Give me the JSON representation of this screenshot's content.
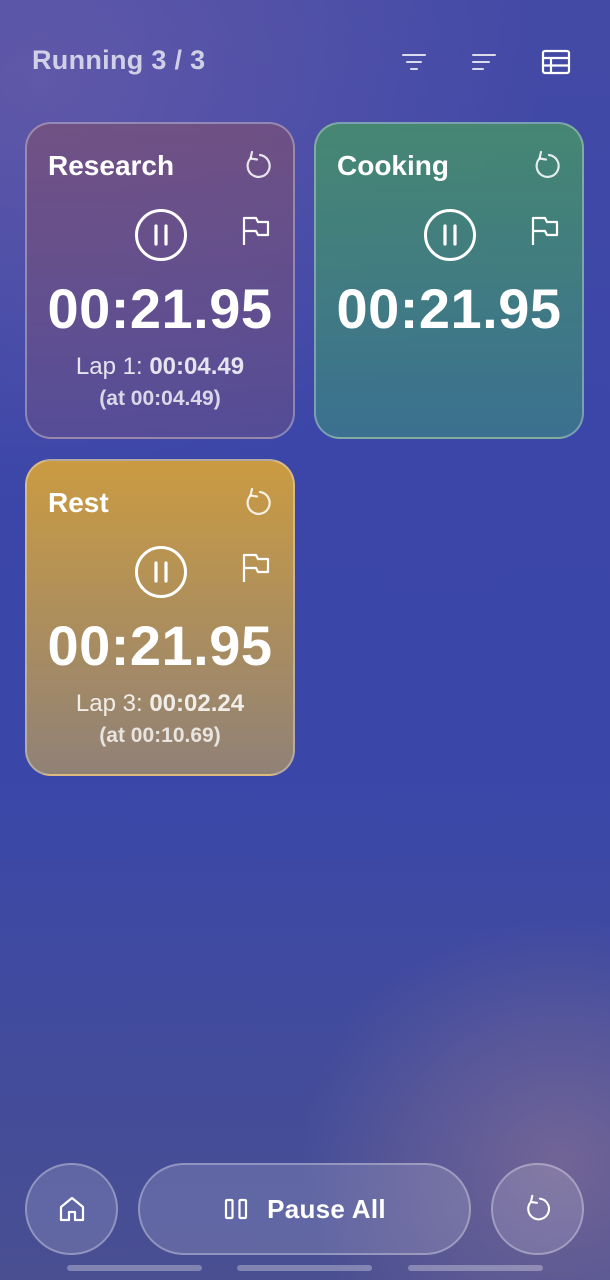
{
  "header": {
    "title": "Running 3 / 3",
    "icons": [
      "filter-icon",
      "sort-icon",
      "table-view-icon"
    ]
  },
  "timers": [
    {
      "name": "Research",
      "time": "00:21.95",
      "lap_label": "Lap 1: ",
      "lap_time": "00:04.49",
      "lap_at": "(at 00:04.49)",
      "color": "#6e5a8a"
    },
    {
      "name": "Cooking",
      "time": "00:21.95",
      "color": "#4a8a86"
    },
    {
      "name": "Rest",
      "time": "00:21.95",
      "lap_label": "Lap 3: ",
      "lap_time": "00:02.24",
      "lap_at": "(at 00:10.69)",
      "color": "#b8964c"
    }
  ],
  "bottom": {
    "pause_all_label": "Pause All",
    "icons": [
      "home-icon",
      "pause-icon",
      "reset-icon"
    ]
  }
}
